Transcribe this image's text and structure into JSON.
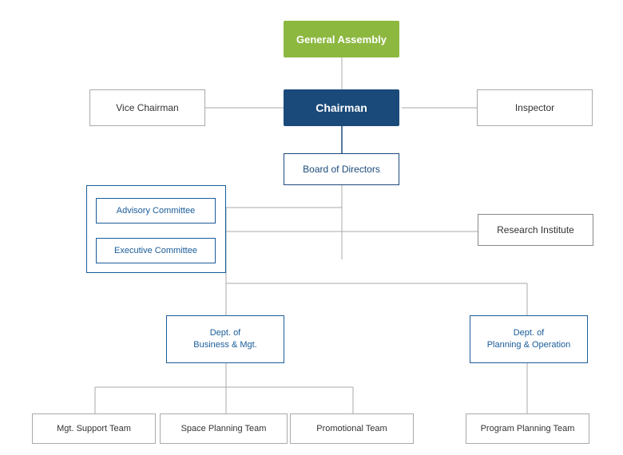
{
  "nodes": {
    "general_assembly": {
      "label": "General Assembly"
    },
    "chairman": {
      "label": "Chairman"
    },
    "vice_chairman": {
      "label": "Vice Chairman"
    },
    "inspector": {
      "label": "Inspector"
    },
    "board_of_directors": {
      "label": "Board of Directors"
    },
    "advisory_committee": {
      "label": "Advisory Committee"
    },
    "executive_committee": {
      "label": "Executive Committee"
    },
    "research_institute": {
      "label": "Research Institute"
    },
    "dept_business": {
      "label": "Dept. of\nBusiness & Mgt."
    },
    "dept_planning": {
      "label": "Dept. of\nPlanning & Operation"
    },
    "mgt_support_team": {
      "label": "Mgt. Support Team"
    },
    "space_planning_team": {
      "label": "Space Planning Team"
    },
    "promotional_team": {
      "label": "Promotional Team"
    },
    "program_planning_team": {
      "label": "Program Planning Team"
    }
  }
}
